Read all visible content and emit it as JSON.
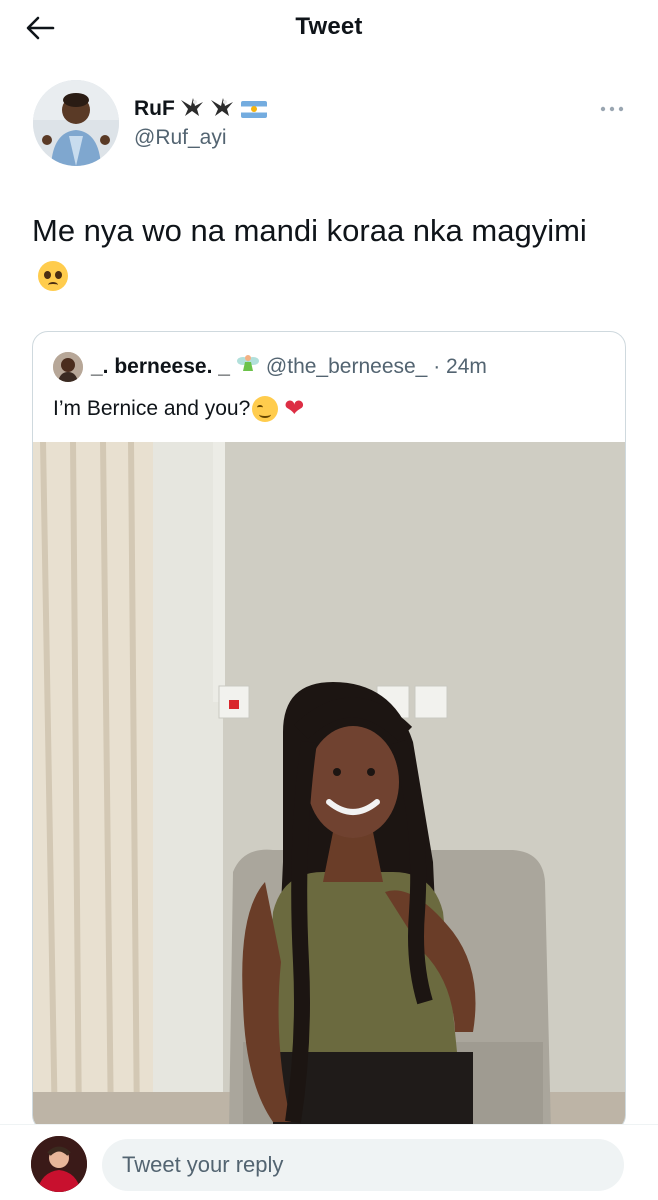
{
  "header": {
    "title": "Tweet",
    "back_icon": "arrow-left-icon"
  },
  "tweet": {
    "author_name": "RuF",
    "author_handle": "@Ruf_ayi",
    "author_badges": [
      "eagle-icon",
      "eagle-icon",
      "argentina-flag-icon"
    ],
    "text": "Me nya wo na mandi koraa nka magyimi",
    "text_emoji": "pleading-face-emoji",
    "more_icon": "more-dots-icon"
  },
  "quoted_tweet": {
    "name": "_. berneese. _",
    "name_emoji": "fairy-emoji",
    "handle_time": "@the_berneese_ · 24m",
    "text": "I’m Bernice and you?",
    "text_emojis": [
      "smiling-face-emoji",
      "red-heart-emoji"
    ],
    "media": "photo-woman-seated"
  },
  "reply": {
    "placeholder": "Tweet your reply"
  },
  "colors": {
    "text_primary": "#0f1419",
    "text_secondary": "#536471",
    "border": "#cfd9de",
    "reply_bg": "#eff3f4"
  }
}
